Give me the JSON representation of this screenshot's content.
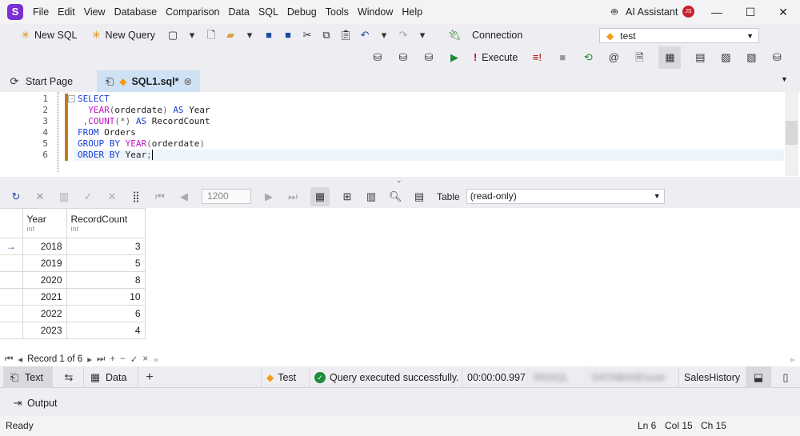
{
  "app": {
    "logo": "S",
    "menu": [
      "File",
      "Edit",
      "View",
      "Database",
      "Comparison",
      "Data",
      "SQL",
      "Debug",
      "Tools",
      "Window",
      "Help"
    ],
    "ai_assistant": "AI Assistant",
    "user_initials": "JS"
  },
  "toolbar": {
    "new_sql": "New SQL",
    "new_query": "New Query",
    "connection_label": "Connection",
    "connection_value": "test",
    "execute": "Execute"
  },
  "tabs": [
    {
      "label": "Start Page"
    },
    {
      "label": "SQL1.sql*",
      "active": true
    }
  ],
  "editor": {
    "line_numbers": [
      "1",
      "2",
      "3",
      "4",
      "5",
      "6"
    ]
  },
  "grid_toolbar": {
    "page_size": "1200",
    "view_label": "Table",
    "view_value": "(read-only)"
  },
  "grid": {
    "columns": [
      {
        "name": "Year",
        "type": "int"
      },
      {
        "name": "RecordCount",
        "type": "int"
      }
    ],
    "rows": [
      [
        "2018",
        "3"
      ],
      [
        "2019",
        "5"
      ],
      [
        "2020",
        "8"
      ],
      [
        "2021",
        "10"
      ],
      [
        "2022",
        "6"
      ],
      [
        "2023",
        "4"
      ]
    ]
  },
  "navigator": {
    "record": "Record 1 of 6"
  },
  "bottom_tabs": {
    "text": "Text",
    "data": "Data",
    "connection": "Test",
    "message": "Query executed successfully.",
    "elapsed": "00:00:00.997",
    "server": "MSSQL",
    "user": "DATABASE\\user",
    "database": "SalesHistory"
  },
  "output": {
    "label": "Output"
  },
  "status": {
    "state": "Ready",
    "ln": "Ln 6",
    "col": "Col 15",
    "ch": "Ch 15"
  },
  "colors": {
    "accent": "#7a2fd0",
    "active_tab": "#cfe1f5",
    "gutter_bar": "#c27c20"
  }
}
